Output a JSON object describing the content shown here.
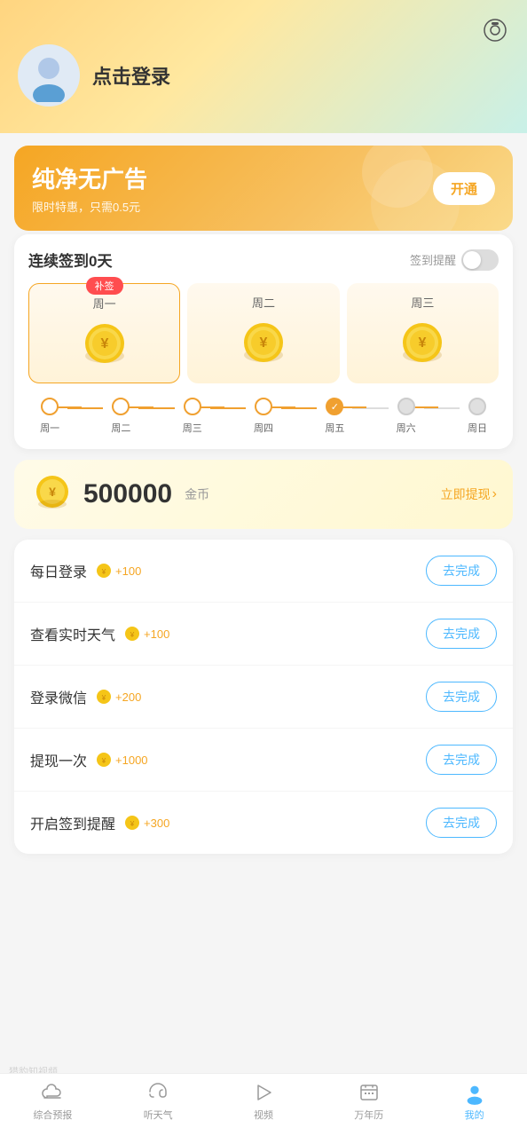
{
  "header": {
    "camera_label": "camera",
    "login_text": "点击登录"
  },
  "vip_banner": {
    "title": "纯净无广告",
    "subtitle": "限时特惠，只需0.5元",
    "button": "开通"
  },
  "signin": {
    "title": "连续签到0天",
    "reminder_label": "签到提醒",
    "badge": "补签",
    "days": [
      {
        "label": "周一",
        "type": "active"
      },
      {
        "label": "周二",
        "type": "normal"
      },
      {
        "label": "周三",
        "type": "normal"
      }
    ],
    "progress": [
      {
        "label": "周一",
        "state": "empty"
      },
      {
        "label": "周二",
        "state": "empty"
      },
      {
        "label": "周三",
        "state": "empty"
      },
      {
        "label": "周四",
        "state": "empty"
      },
      {
        "label": "周五",
        "state": "checked"
      },
      {
        "label": "周六",
        "state": "gray"
      },
      {
        "label": "周日",
        "state": "gray"
      }
    ]
  },
  "coins": {
    "amount": "500000",
    "unit": "金币",
    "withdraw_text": "立即提现"
  },
  "tasks": [
    {
      "name": "每日登录",
      "reward": "+100",
      "button": "去完成"
    },
    {
      "name": "查看实时天气",
      "reward": "+100",
      "button": "去完成"
    },
    {
      "name": "登录微信",
      "reward": "+200",
      "button": "去完成"
    },
    {
      "name": "提现一次",
      "reward": "+1000",
      "button": "去完成"
    },
    {
      "name": "开启签到提醒",
      "reward": "+300",
      "button": "去完成"
    }
  ],
  "nav": [
    {
      "label": "综合预报",
      "active": false
    },
    {
      "label": "听天气",
      "active": false
    },
    {
      "label": "视频",
      "active": false
    },
    {
      "label": "万年历",
      "active": false
    },
    {
      "label": "我的",
      "active": true
    }
  ],
  "watermark": "猎豹知视频"
}
